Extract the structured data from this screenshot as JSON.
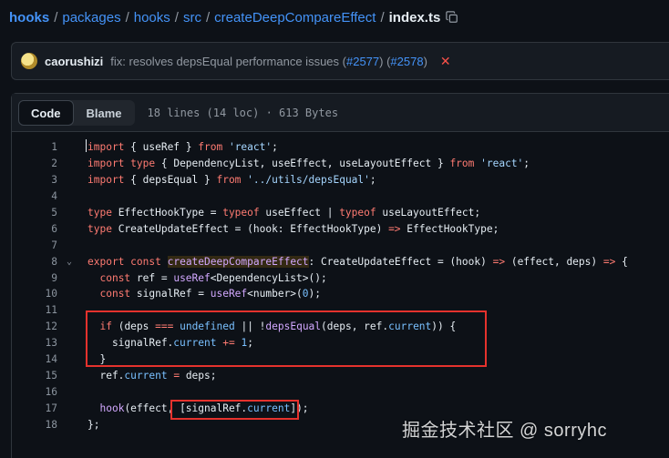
{
  "breadcrumb": {
    "items": [
      "hooks",
      "packages",
      "hooks",
      "src",
      "createDeepCompareEffect"
    ],
    "separator": "/",
    "current": "index.ts"
  },
  "commit": {
    "author": "caorushizi",
    "message": "fix: resolves depsEqual performance issues (",
    "pr1": "#2577",
    "mid": ") (",
    "pr2": "#2578",
    "end": ")",
    "status_icon": "x-icon"
  },
  "file": {
    "tabs": [
      "Code",
      "Blame"
    ],
    "active_tab": "Code",
    "meta": "18 lines (14 loc) · 613 Bytes"
  },
  "code": {
    "line_numbers": [
      "1",
      "2",
      "3",
      "4",
      "5",
      "6",
      "7",
      "8",
      "9",
      "10",
      "11",
      "12",
      "13",
      "14",
      "15",
      "16",
      "17",
      "18"
    ],
    "lines": {
      "l1": [
        "import",
        " { useRef } ",
        "from",
        " ",
        "'react'",
        ";"
      ],
      "l2": [
        "import",
        " ",
        "type",
        " { DependencyList, useEffect, useLayoutEffect } ",
        "from",
        " ",
        "'react'",
        ";"
      ],
      "l3": [
        "import",
        " { depsEqual } ",
        "from",
        " ",
        "'../utils/depsEqual'",
        ";"
      ],
      "l5": [
        "type",
        " EffectHookType = ",
        "typeof",
        " useEffect | ",
        "typeof",
        " useLayoutEffect;"
      ],
      "l6": [
        "type",
        " CreateUpdateEffect = (hook: EffectHookType) ",
        "=>",
        " EffectHookType;"
      ],
      "l8": [
        "export",
        " ",
        "const",
        " ",
        "createDeepCompareEffect",
        ": CreateUpdateEffect = (hook) ",
        "=>",
        " (effect, deps) ",
        "=>",
        " {"
      ],
      "l9": [
        "  ",
        "const",
        " ref = ",
        "useRef",
        "<DependencyList>();"
      ],
      "l10": [
        "  ",
        "const",
        " signalRef = ",
        "useRef",
        "<number>(",
        "0",
        ");"
      ],
      "l12": [
        "  ",
        "if",
        " (deps ",
        "===",
        " ",
        "undefined",
        " || !",
        "depsEqual",
        "(deps, ref.",
        "current",
        ")) {"
      ],
      "l13": [
        "    signalRef.",
        "current",
        " ",
        "+=",
        " ",
        "1",
        ";"
      ],
      "l14": [
        "  }"
      ],
      "l15": [
        "  ref.",
        "current",
        " ",
        "=",
        " deps;"
      ],
      "l17": [
        "  ",
        "hook",
        "(effect, ",
        "[signalRef.",
        "current",
        "]",
        ");"
      ],
      "l18": [
        "};"
      ]
    }
  },
  "watermark": "掘金技术社区 @ sorryhc",
  "colors": {
    "background": "#0d1117",
    "link": "#4493f8",
    "keyword": "#ff7b72",
    "string": "#a5d6ff",
    "function": "#d2a8ff",
    "highlight_box": "#e5322d"
  }
}
